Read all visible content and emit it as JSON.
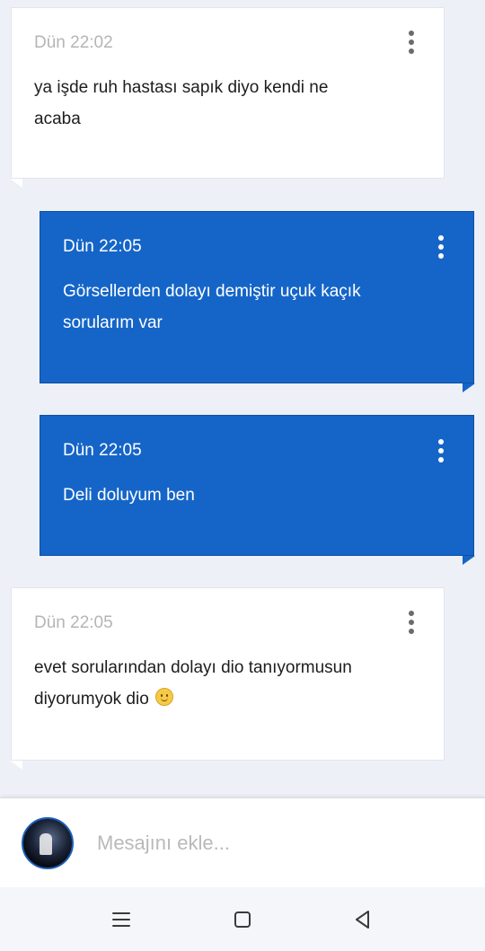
{
  "messages": [
    {
      "direction": "incoming",
      "time": "Dün 22:02",
      "lines": [
        "ya işde ruh hastası sapık diyo kendi ne",
        "acaba"
      ],
      "emoji": null
    },
    {
      "direction": "outgoing",
      "time": "Dün 22:05",
      "lines": [
        "Görsellerden dolayı demiştir uçuk kaçık",
        "sorularım var"
      ],
      "emoji": null
    },
    {
      "direction": "outgoing",
      "time": "Dün 22:05",
      "lines": [
        "Deli doluyum ben"
      ],
      "emoji": null
    },
    {
      "direction": "incoming",
      "time": "Dün 22:05",
      "lines": [
        "evet sorularından dolayı dio tanıyormusun",
        "diyorumyok dio"
      ],
      "emoji": "slightly-smiling-face"
    }
  ],
  "composer": {
    "placeholder": "Mesajını ekle..."
  },
  "navbar": {
    "icons": [
      "menu-icon",
      "home-square-icon",
      "back-triangle-icon"
    ]
  },
  "colors": {
    "outgoing_bubble": "#1565c8",
    "incoming_bubble": "#ffffff",
    "background": "#eef0f8"
  }
}
